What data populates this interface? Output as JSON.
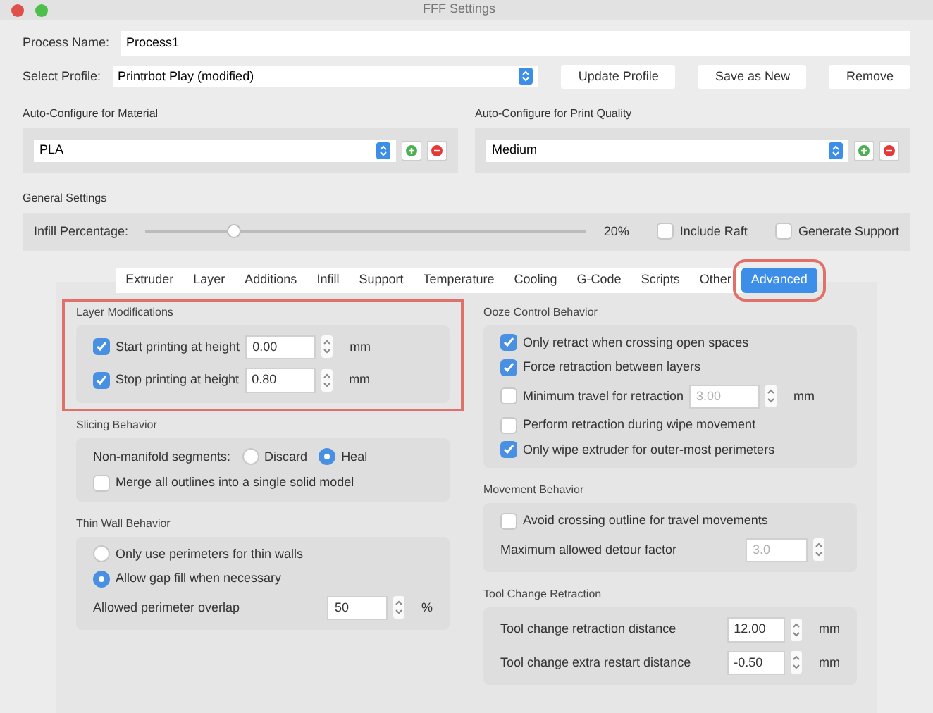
{
  "window": {
    "title": "FFF Settings"
  },
  "process_name": {
    "label": "Process Name:",
    "value": "Process1"
  },
  "profile": {
    "label": "Select Profile:",
    "value": "Printrbot Play (modified)",
    "buttons": [
      "Update Profile",
      "Save as New",
      "Remove"
    ]
  },
  "auto_configure": [
    {
      "title": "Auto-Configure for Material",
      "value": "PLA"
    },
    {
      "title": "Auto-Configure for Print Quality",
      "value": "Medium"
    }
  ],
  "general": {
    "title": "General Settings",
    "infill_label": "Infill Percentage:",
    "level": 0.2,
    "reading": "20%",
    "options": [
      {
        "label": "Include Raft",
        "checked": false
      },
      {
        "label": "Generate Support",
        "checked": false
      }
    ]
  },
  "tabs": [
    {
      "label": "Extruder",
      "selected": false,
      "highlighted": false
    },
    {
      "label": "Layer",
      "selected": false,
      "highlighted": false
    },
    {
      "label": "Additions",
      "selected": false,
      "highlighted": false
    },
    {
      "label": "Infill",
      "selected": false,
      "highlighted": false
    },
    {
      "label": "Support",
      "selected": false,
      "highlighted": false
    },
    {
      "label": "Temperature",
      "selected": false,
      "highlighted": false
    },
    {
      "label": "Cooling",
      "selected": false,
      "highlighted": false
    },
    {
      "label": "G-Code",
      "selected": false,
      "highlighted": false
    },
    {
      "label": "Scripts",
      "selected": false,
      "highlighted": false
    },
    {
      "label": "Other",
      "selected": false,
      "highlighted": false
    },
    {
      "label": "Advanced",
      "selected": true,
      "highlighted": true
    }
  ],
  "columns": [
    [
      {
        "title": "Layer Modifications",
        "highlighted": true,
        "rows": [
          {
            "kind": "check_input",
            "label": "Start printing at height",
            "checked": true,
            "value": "0.00",
            "unit": "mm",
            "disabled": false
          },
          {
            "kind": "check_input",
            "label": "Stop printing at height",
            "checked": true,
            "value": "0.80",
            "unit": "mm",
            "disabled": false
          }
        ]
      },
      {
        "title": "Slicing Behavior",
        "highlighted": false,
        "rows": [
          {
            "kind": "radios",
            "label": "Non-manifold segments:",
            "options": [
              {
                "label": "Discard",
                "selected": false
              },
              {
                "label": "Heal",
                "selected": true
              }
            ]
          },
          {
            "kind": "checkbox",
            "label": "Merge all outlines into a single solid model",
            "checked": false
          }
        ]
      },
      {
        "title": "Thin Wall Behavior",
        "highlighted": false,
        "rows": [
          {
            "kind": "radio",
            "label": "Only use perimeters for thin walls",
            "selected": false
          },
          {
            "kind": "radio",
            "label": "Allow gap fill when necessary",
            "selected": true
          },
          {
            "kind": "input",
            "label": "Allowed perimeter overlap",
            "value": "50",
            "unit": "%",
            "disabled": false
          }
        ]
      }
    ],
    [
      {
        "title": "Ooze Control Behavior",
        "highlighted": false,
        "rows": [
          {
            "kind": "checkbox",
            "label": "Only retract when crossing open spaces",
            "checked": true
          },
          {
            "kind": "checkbox",
            "label": "Force retraction between layers",
            "checked": true
          },
          {
            "kind": "check_input",
            "label": "Minimum travel for retraction",
            "checked": false,
            "value": "3.00",
            "unit": "mm",
            "disabled": true
          },
          {
            "kind": "checkbox",
            "label": "Perform retraction during wipe movement",
            "checked": false
          },
          {
            "kind": "checkbox",
            "label": "Only wipe extruder for outer-most perimeters",
            "checked": true
          }
        ]
      },
      {
        "title": "Movement Behavior",
        "highlighted": false,
        "rows": [
          {
            "kind": "checkbox",
            "label": "Avoid crossing outline for travel movements",
            "checked": false
          },
          {
            "kind": "input",
            "label": "Maximum allowed detour factor",
            "value": "3.0",
            "disabled": true
          }
        ]
      },
      {
        "title": "Tool Change Retraction",
        "highlighted": false,
        "rows": [
          {
            "kind": "input",
            "label": "Tool change retraction distance",
            "value": "12.00",
            "unit": "mm",
            "disabled": false
          },
          {
            "kind": "input",
            "label": "Tool change extra restart distance",
            "value": "-0.50",
            "unit": "mm",
            "disabled": false
          }
        ]
      }
    ]
  ]
}
